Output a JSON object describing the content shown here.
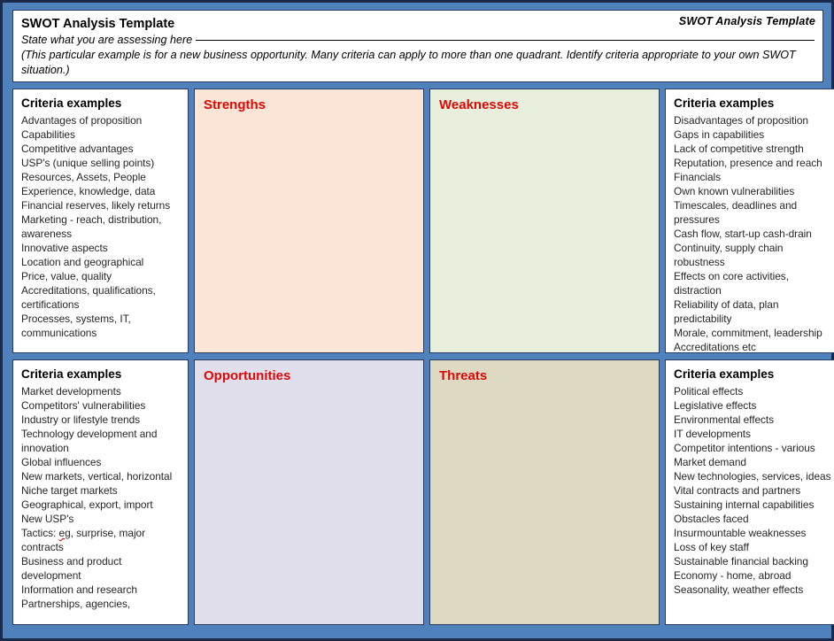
{
  "document": {
    "title": "SWOT Analysis Template",
    "corner_label": "SWOT Analysis Template",
    "subtitle_prompt": "State what you are assessing  here",
    "note": "(This particular example is for a new business opportunity. Many criteria can apply to more than one quadrant. Identify criteria appropriate to your own SWOT situation.)",
    "criteria_heading": "Criteria examples",
    "colors": {
      "page_border": "#1b2a4a",
      "frame": "#4f81bd",
      "cell_border": "#2a3b5e",
      "quadrant_heading": "#dd0806",
      "body_text": "#262626",
      "strengths_bg": "#fbe5d6",
      "weaknesses_bg": "#e9efdd",
      "opportunities_bg": "#e2dfec",
      "threats_bg": "#ddd9c3"
    }
  },
  "quadrants": {
    "strengths": {
      "label": "Strengths"
    },
    "weaknesses": {
      "label": "Weaknesses"
    },
    "opportunities": {
      "label": "Opportunities"
    },
    "threats": {
      "label": "Threats"
    }
  },
  "criteria": {
    "strengths": {
      "heading": "Criteria examples",
      "items": [
        "Advantages of proposition",
        "Capabilities",
        "Competitive advantages",
        "USP's (unique selling points)",
        "Resources, Assets, People",
        "Experience, knowledge, data",
        "Financial reserves, likely returns",
        "Marketing - reach, distribution,",
        "awareness",
        "Innovative aspects",
        "Location and geographical",
        "Price, value, quality",
        "Accreditations, qualifications,",
        "certifications",
        "Processes, systems, IT,",
        "communications"
      ]
    },
    "weaknesses": {
      "heading": "Criteria examples",
      "items": [
        "Disadvantages of proposition",
        "Gaps in capabilities",
        "Lack of competitive strength",
        "Reputation, presence and reach",
        "Financials",
        "Own known vulnerabilities",
        "Timescales, deadlines and",
        "pressures",
        "Cash flow, start-up cash-drain",
        "Continuity, supply chain",
        "robustness",
        "Effects on core activities,",
        "distraction",
        "Reliability of data, plan",
        "predictability",
        "Morale, commitment, leadership",
        "Accreditations etc"
      ]
    },
    "opportunities": {
      "heading": "Criteria examples",
      "items": [
        "Market developments",
        "Competitors' vulnerabilities",
        "Industry or lifestyle trends",
        "Technology development and",
        "innovation",
        "Global influences",
        "New markets, vertical, horizontal",
        "Niche target markets",
        "Geographical, export, import",
        "New USP's",
        "Tactics: eg, surprise, major",
        "contracts",
        "Business and product",
        "development",
        "Information and research",
        "Partnerships, agencies,"
      ],
      "misspelled_token": "eg"
    },
    "threats": {
      "heading": "Criteria examples",
      "items": [
        "Political effects",
        "Legislative effects",
        "Environmental effects",
        "IT developments",
        "Competitor intentions - various",
        "Market demand",
        "New technologies, services, ideas",
        "Vital contracts and partners",
        "Sustaining internal capabilities",
        "Obstacles faced",
        "Insurmountable weaknesses",
        "Loss of key staff",
        "Sustainable financial backing",
        "Economy - home, abroad",
        "Seasonality, weather effects"
      ]
    }
  }
}
